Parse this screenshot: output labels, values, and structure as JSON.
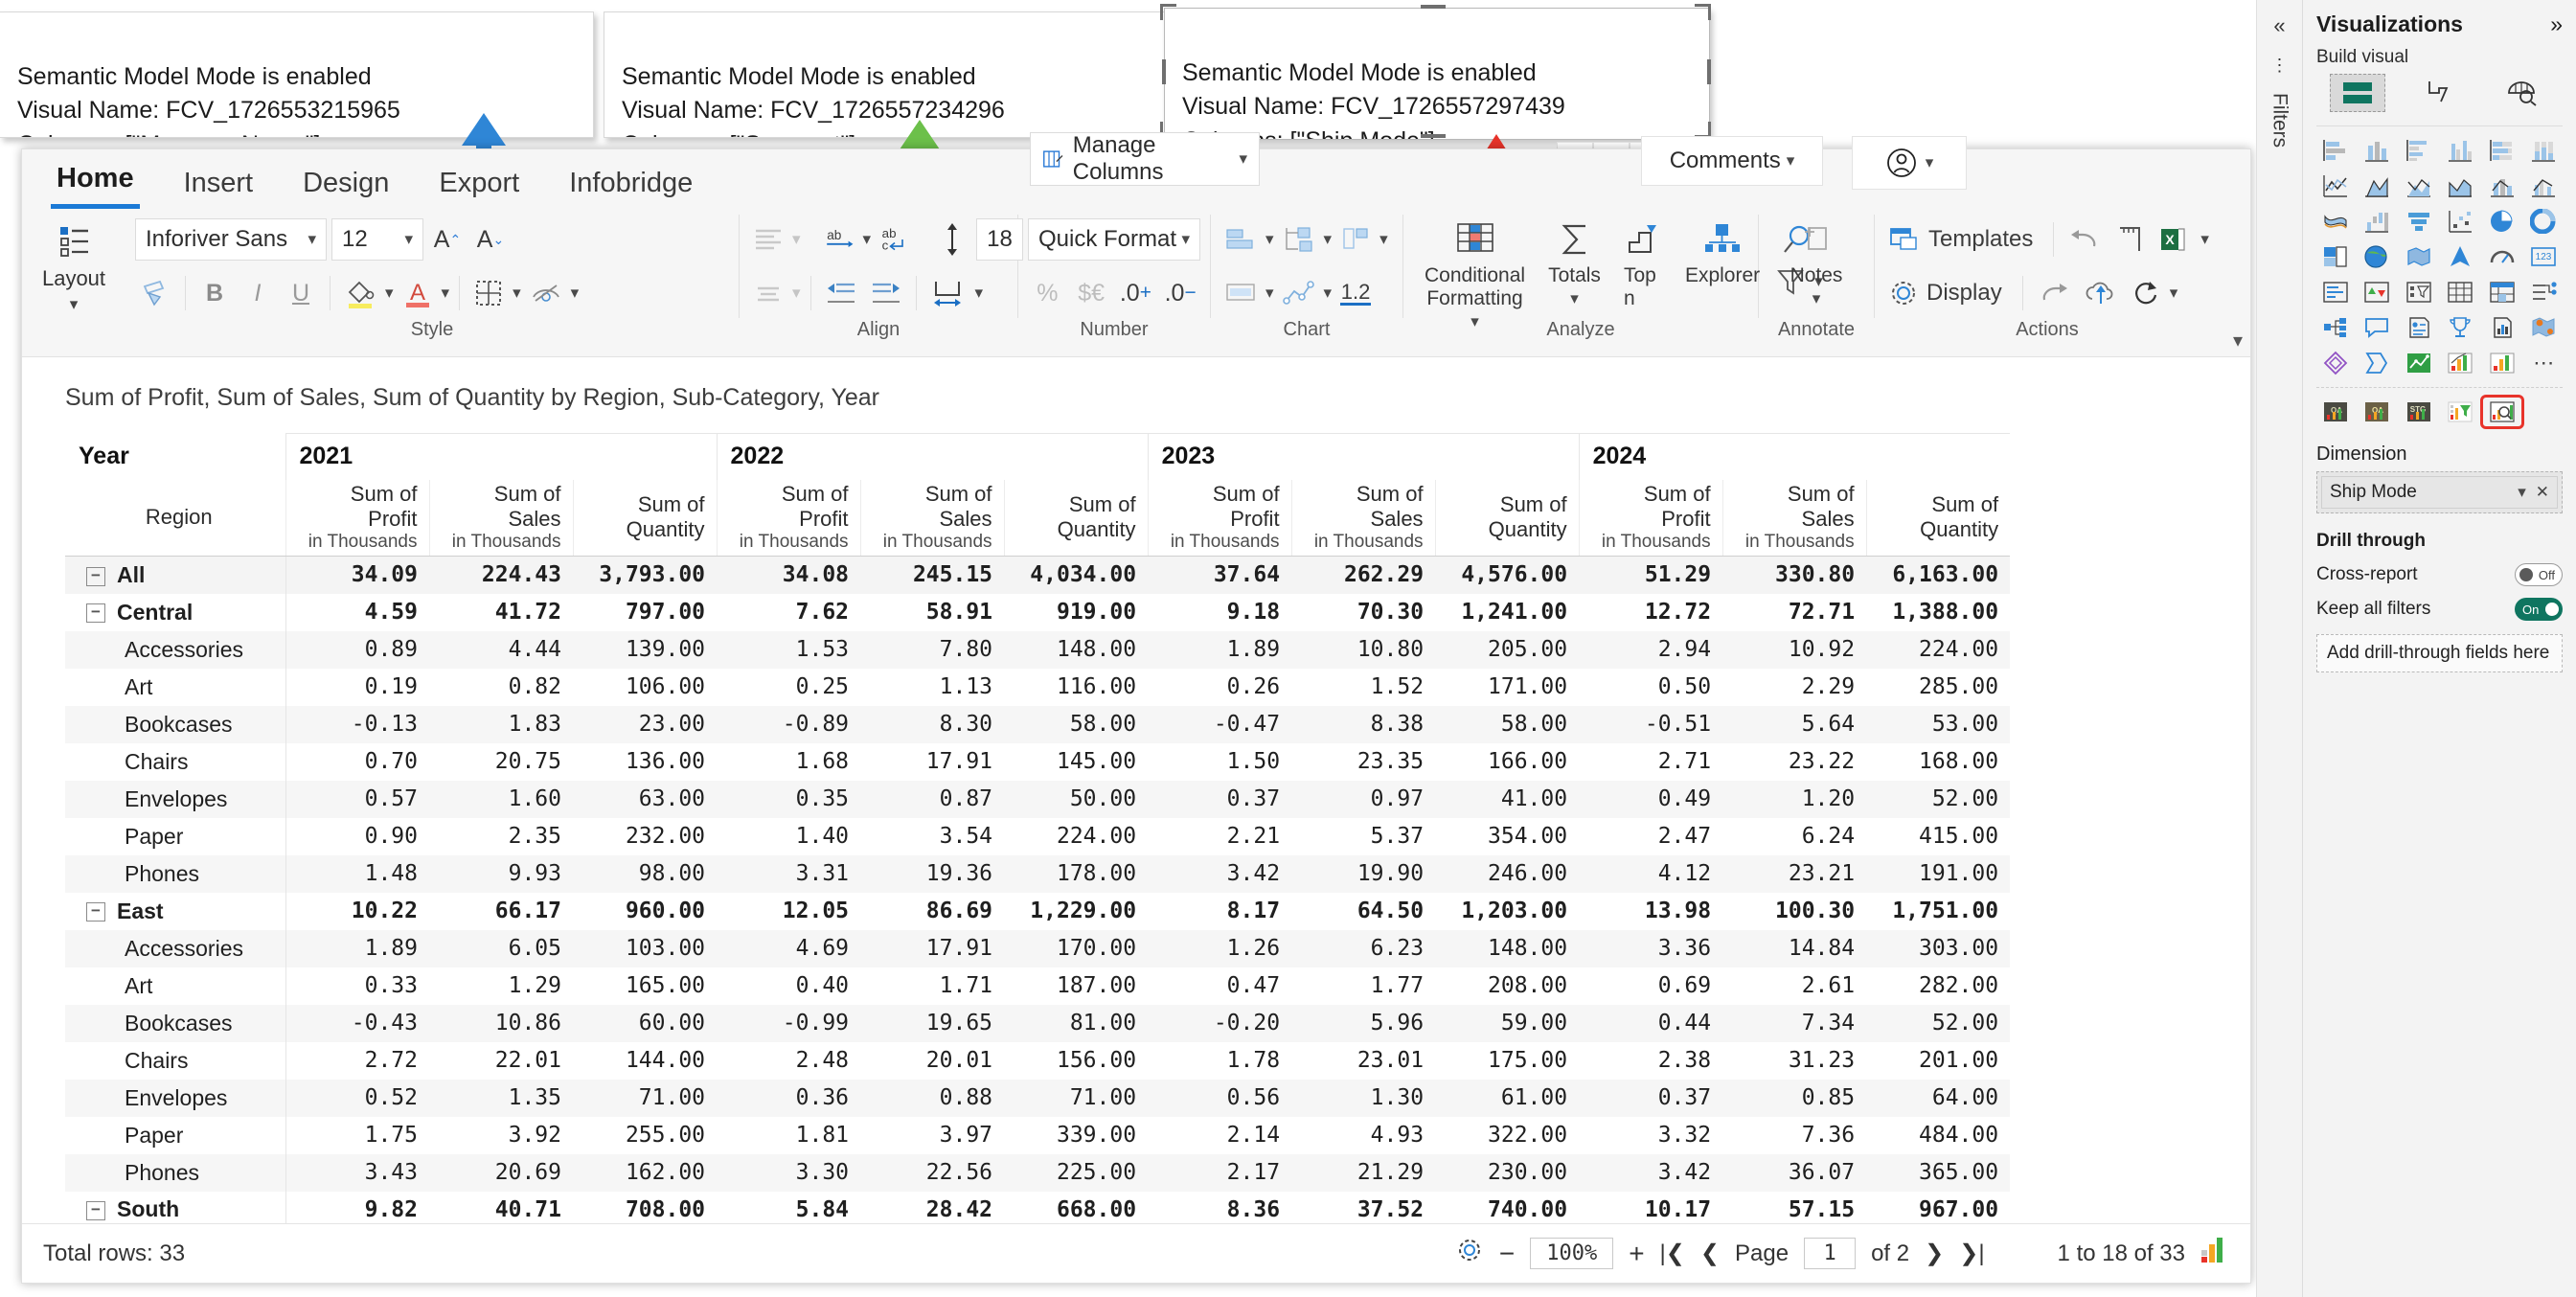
{
  "callouts": [
    {
      "id": "c1",
      "text": "Semantic Model Mode is enabled\nVisual Name: FCV_1726553215965\nColumns: [\"Manager Name\"]",
      "arrow_color": "#2f86d6"
    },
    {
      "id": "c2",
      "text": "Semantic Model Mode is enabled\nVisual Name: FCV_1726557234296\nColumns: [\"Segment\"]",
      "arrow_color": "#6cc04a"
    },
    {
      "id": "c3",
      "text": "Semantic Model Mode is enabled\nVisual Name: FCV_1726557297439\nColumns: [\"Ship Mode\"]",
      "arrow_color": "#e8332a"
    }
  ],
  "ribbon": {
    "tabs": [
      {
        "label": "Home",
        "active": true
      },
      {
        "label": "Insert",
        "active": false
      },
      {
        "label": "Design",
        "active": false
      },
      {
        "label": "Export",
        "active": false
      },
      {
        "label": "Infobridge",
        "active": false
      }
    ],
    "manage_columns": "Manage Columns",
    "comments": "Comments",
    "groups": {
      "layout": "Layout",
      "style": "Style",
      "align": "Align",
      "number": "Number",
      "chart": "Chart",
      "analyze": "Analyze",
      "annotate": "Annotate",
      "actions": "Actions"
    },
    "font_name": "Inforiver Sans",
    "font_size": "12",
    "row_height": "18",
    "quick_format": "Quick Format",
    "decimal_label": "1.2",
    "conditional_formatting": "Conditional\nFormatting",
    "totals": "Totals",
    "topn": "Top n",
    "explorer": "Explorer",
    "notes": "Notes",
    "templates": "Templates",
    "display": "Display"
  },
  "visual": {
    "title": "Sum of Profit, Sum of Sales, Sum of Quantity by Region, Sub-Category, Year",
    "corner_header": "Year",
    "row_header": "Region",
    "year_groups": [
      "2021",
      "2022",
      "2023",
      "2024"
    ],
    "measures": [
      {
        "name": "Sum of Profit",
        "sub": "in Thousands"
      },
      {
        "name": "Sum of Sales",
        "sub": "in Thousands"
      },
      {
        "name": "Sum of\nQuantity",
        "sub": ""
      }
    ],
    "rows": [
      {
        "label": "All",
        "level": 0,
        "expander": "−",
        "values": [
          "34.09",
          "224.43",
          "3,793.00",
          "34.08",
          "245.15",
          "4,034.00",
          "37.64",
          "262.29",
          "4,576.00",
          "51.29",
          "330.80",
          "6,163.00"
        ]
      },
      {
        "label": "Central",
        "level": 1,
        "expander": "−",
        "values": [
          "4.59",
          "41.72",
          "797.00",
          "7.62",
          "58.91",
          "919.00",
          "9.18",
          "70.30",
          "1,241.00",
          "12.72",
          "72.71",
          "1,388.00"
        ]
      },
      {
        "label": "Accessories",
        "level": 2,
        "expander": "",
        "values": [
          "0.89",
          "4.44",
          "139.00",
          "1.53",
          "7.80",
          "148.00",
          "1.89",
          "10.80",
          "205.00",
          "2.94",
          "10.92",
          "224.00"
        ]
      },
      {
        "label": "Art",
        "level": 2,
        "expander": "",
        "values": [
          "0.19",
          "0.82",
          "106.00",
          "0.25",
          "1.13",
          "116.00",
          "0.26",
          "1.52",
          "171.00",
          "0.50",
          "2.29",
          "285.00"
        ]
      },
      {
        "label": "Bookcases",
        "level": 2,
        "expander": "",
        "values": [
          "-0.13",
          "1.83",
          "23.00",
          "-0.89",
          "8.30",
          "58.00",
          "-0.47",
          "8.38",
          "58.00",
          "-0.51",
          "5.64",
          "53.00"
        ]
      },
      {
        "label": "Chairs",
        "level": 2,
        "expander": "",
        "values": [
          "0.70",
          "20.75",
          "136.00",
          "1.68",
          "17.91",
          "145.00",
          "1.50",
          "23.35",
          "166.00",
          "2.71",
          "23.22",
          "168.00"
        ]
      },
      {
        "label": "Envelopes",
        "level": 2,
        "expander": "",
        "values": [
          "0.57",
          "1.60",
          "63.00",
          "0.35",
          "0.87",
          "50.00",
          "0.37",
          "0.97",
          "41.00",
          "0.49",
          "1.20",
          "52.00"
        ]
      },
      {
        "label": "Paper",
        "level": 2,
        "expander": "",
        "values": [
          "0.90",
          "2.35",
          "232.00",
          "1.40",
          "3.54",
          "224.00",
          "2.21",
          "5.37",
          "354.00",
          "2.47",
          "6.24",
          "415.00"
        ]
      },
      {
        "label": "Phones",
        "level": 2,
        "expander": "",
        "values": [
          "1.48",
          "9.93",
          "98.00",
          "3.31",
          "19.36",
          "178.00",
          "3.42",
          "19.90",
          "246.00",
          "4.12",
          "23.21",
          "191.00"
        ]
      },
      {
        "label": "East",
        "level": 1,
        "expander": "−",
        "values": [
          "10.22",
          "66.17",
          "960.00",
          "12.05",
          "86.69",
          "1,229.00",
          "8.17",
          "64.50",
          "1,203.00",
          "13.98",
          "100.30",
          "1,751.00"
        ]
      },
      {
        "label": "Accessories",
        "level": 2,
        "expander": "",
        "values": [
          "1.89",
          "6.05",
          "103.00",
          "4.69",
          "17.91",
          "170.00",
          "1.26",
          "6.23",
          "148.00",
          "3.36",
          "14.84",
          "303.00"
        ]
      },
      {
        "label": "Art",
        "level": 2,
        "expander": "",
        "values": [
          "0.33",
          "1.29",
          "165.00",
          "0.40",
          "1.71",
          "187.00",
          "0.47",
          "1.77",
          "208.00",
          "0.69",
          "2.61",
          "282.00"
        ]
      },
      {
        "label": "Bookcases",
        "level": 2,
        "expander": "",
        "values": [
          "-0.43",
          "10.86",
          "60.00",
          "-0.99",
          "19.65",
          "81.00",
          "-0.20",
          "5.96",
          "59.00",
          "0.44",
          "7.34",
          "52.00"
        ]
      },
      {
        "label": "Chairs",
        "level": 2,
        "expander": "",
        "values": [
          "2.72",
          "22.01",
          "144.00",
          "2.48",
          "20.01",
          "156.00",
          "1.78",
          "23.01",
          "175.00",
          "2.38",
          "31.23",
          "201.00"
        ]
      },
      {
        "label": "Envelopes",
        "level": 2,
        "expander": "",
        "values": [
          "0.52",
          "1.35",
          "71.00",
          "0.36",
          "0.88",
          "71.00",
          "0.56",
          "1.30",
          "61.00",
          "0.37",
          "0.85",
          "64.00"
        ]
      },
      {
        "label": "Paper",
        "level": 2,
        "expander": "",
        "values": [
          "1.75",
          "3.92",
          "255.00",
          "1.81",
          "3.97",
          "339.00",
          "2.14",
          "4.93",
          "322.00",
          "3.32",
          "7.36",
          "484.00"
        ]
      },
      {
        "label": "Phones",
        "level": 2,
        "expander": "",
        "values": [
          "3.43",
          "20.69",
          "162.00",
          "3.30",
          "22.56",
          "225.00",
          "2.17",
          "21.29",
          "230.00",
          "3.42",
          "36.07",
          "365.00"
        ]
      },
      {
        "label": "South",
        "level": 1,
        "expander": "−",
        "values": [
          "9.82",
          "40.71",
          "708.00",
          "5.84",
          "28.42",
          "668.00",
          "8.36",
          "37.52",
          "740.00",
          "10.17",
          "57.15",
          "967.00"
        ]
      }
    ]
  },
  "status": {
    "total_rows": "Total rows: 33",
    "zoom": "100%",
    "page_label": "Page",
    "page_value": "1",
    "page_of": "of 2",
    "range": "1 to 18 of 33"
  },
  "viz_panel": {
    "title": "Visualizations",
    "build_visual": "Build visual",
    "dimension_label": "Dimension",
    "dimension_value": "Ship Mode",
    "drill_through": "Drill through",
    "cross_report": "Cross-report",
    "cross_report_state": "Off",
    "keep_all_filters": "Keep all filters",
    "keep_all_filters_state": "On",
    "drill_placeholder": "Add drill-through fields here",
    "filters_rail": "Filters"
  }
}
